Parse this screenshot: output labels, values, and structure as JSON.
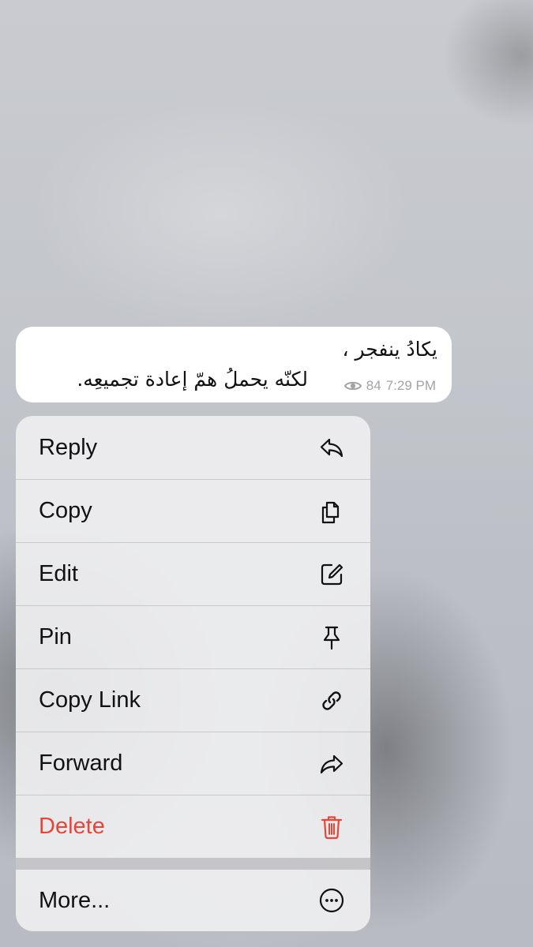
{
  "message": {
    "lines": [
      "يكادُ ينفجر ،",
      "لكنّه يحملُ همّ إعادة تجميعِه."
    ],
    "views": "84",
    "time": "7:29 PM"
  },
  "menu": {
    "items": [
      {
        "label": "Reply",
        "icon": "reply-icon"
      },
      {
        "label": "Copy",
        "icon": "copy-icon"
      },
      {
        "label": "Edit",
        "icon": "edit-icon"
      },
      {
        "label": "Pin",
        "icon": "pin-icon"
      },
      {
        "label": "Copy Link",
        "icon": "link-icon"
      },
      {
        "label": "Forward",
        "icon": "forward-icon"
      },
      {
        "label": "Delete",
        "icon": "trash-icon",
        "color": "#e5463a"
      }
    ],
    "more": {
      "label": "More...",
      "icon": "more-icon"
    }
  },
  "colors": {
    "danger": "#e5463a",
    "meta_text": "#a3a3a8"
  }
}
